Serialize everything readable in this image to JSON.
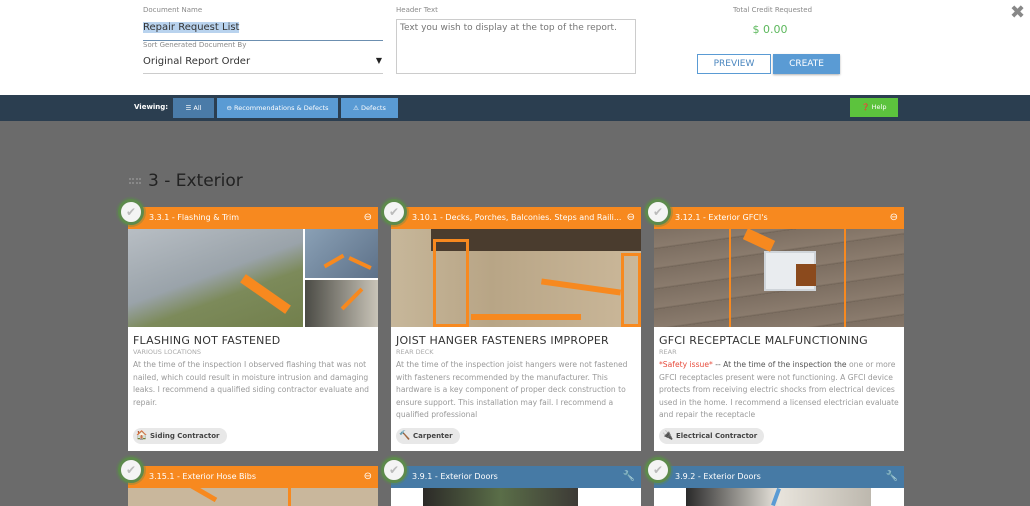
{
  "form": {
    "document_name_label": "Document Name",
    "document_name_value": "Repair Request List",
    "sort_label": "Sort Generated Document By",
    "sort_value": "Original Report Order",
    "header_text_label": "Header Text",
    "header_text_placeholder": "Text you wish to display at the top of the report.",
    "total_credit_label": "Total Credit Requested",
    "total_credit_value": "$ 0.00",
    "preview_label": "PREVIEW",
    "create_label": "CREATE",
    "close_icon": "✖"
  },
  "toolbar": {
    "viewing_label": "Viewing:",
    "filters": [
      {
        "label": "☰ All",
        "active": true
      },
      {
        "label": "⊖ Recommendations & Defects",
        "active": false
      },
      {
        "label": "⚠ Defects",
        "active": false
      }
    ],
    "help_label": "❓ Help"
  },
  "section": {
    "title": "3 - Exterior"
  },
  "cards": [
    {
      "header": "3.3.1 - Flashing & Trim",
      "header_color": "orange",
      "header_icon": "⊖",
      "title": "FLASHING NOT FASTENED",
      "location": "VARIOUS LOCATIONS",
      "safety_prefix": "",
      "safety_lead": "",
      "description": "At the time of the inspection I observed flashing that was not nailed, which could result in moisture intrusion and damaging leaks. I recommend a qualified siding contractor evaluate and repair.",
      "contractor": "Siding Contractor",
      "contractor_icon": "🏠"
    },
    {
      "header": "3.10.1 - Decks, Porches, Balconies. Steps and Raili...",
      "header_color": "orange",
      "header_icon": "⊖",
      "title": "JOIST HANGER FASTENERS IMPROPER",
      "location": "REAR DECK",
      "safety_prefix": "",
      "safety_lead": "",
      "description": "At the time of the inspection joist hangers were not fastened with fasteners recommended by the manufacturer. This hardware is a key component of proper deck construction to ensure support. This installation may fail. I recommend a qualified professional",
      "contractor": "Carpenter",
      "contractor_icon": "🔨"
    },
    {
      "header": "3.12.1 - Exterior GFCI's",
      "header_color": "orange",
      "header_icon": "⊖",
      "title": "GFCI RECEPTACLE MALFUNCTIONING",
      "location": "REAR",
      "safety_prefix": "*Safety issue*",
      "safety_lead": " -- At the time of the inspection the ",
      "description": " one or more GFCI receptacles present were not functioning. A GFCI device protects from receiving electric shocks from electrical devices used in the home. I recommend a licensed electrician evaluate and repair the receptacle",
      "contractor": "Electrical Contractor",
      "contractor_icon": "🔌"
    },
    {
      "header": "3.15.1 - Exterior Hose Bibs",
      "header_color": "orange",
      "header_icon": "⊖"
    },
    {
      "header": "3.9.1 - Exterior Doors",
      "header_color": "blue",
      "header_icon": "🔧"
    },
    {
      "header": "3.9.2 - Exterior Doors",
      "header_color": "blue",
      "header_icon": "🔧"
    }
  ],
  "check_icon": "✔"
}
